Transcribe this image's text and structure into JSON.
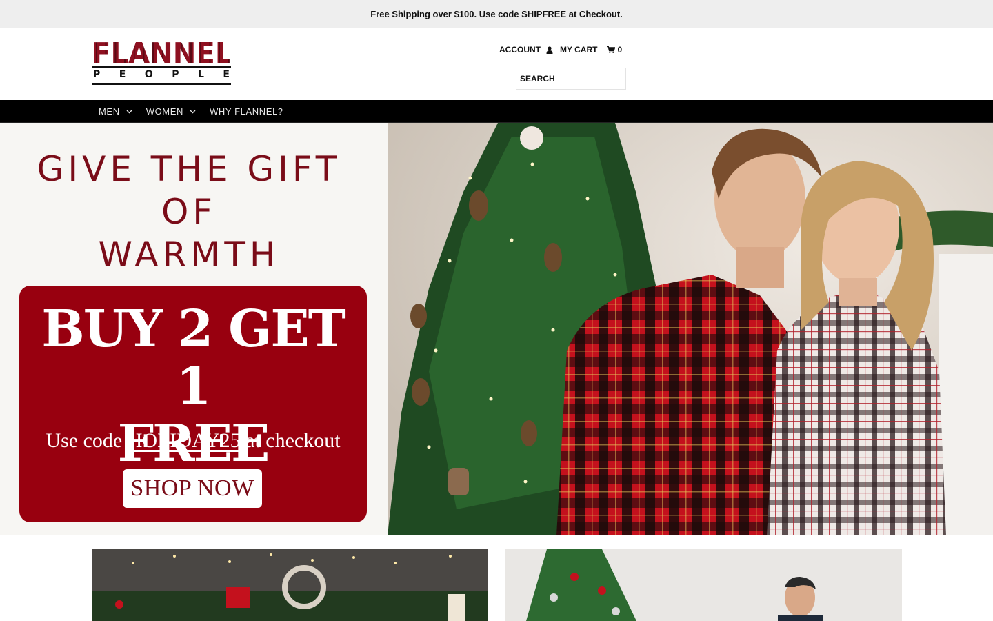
{
  "announcement": "Free Shipping over $100. Use code SHIPFREE at Checkout.",
  "logo": {
    "top": "FLANNEL",
    "bottom": [
      "P",
      "E",
      "O",
      "P",
      "L",
      "E"
    ]
  },
  "header": {
    "account_label": "ACCOUNT",
    "cart_label": "MY CART",
    "cart_count": "0",
    "search_placeholder": "SEARCH"
  },
  "nav": {
    "items": [
      {
        "label": "MEN",
        "has_dropdown": true
      },
      {
        "label": "WOMEN",
        "has_dropdown": true
      },
      {
        "label": "WHY FLANNEL?",
        "has_dropdown": false
      }
    ]
  },
  "hero": {
    "headline": [
      "GIVE THE GIFT",
      "OF",
      "WARMTH"
    ],
    "promo_line1": "BUY 2 GET 1",
    "promo_line2": "FREE",
    "code_prefix": "Use code ",
    "code": "HOLIDAY25",
    "code_suffix": " at checkout",
    "cta": "SHOP NOW"
  },
  "colors": {
    "brand_red": "#98000f",
    "headline_red": "#7a0c18",
    "nav_bg": "#000000",
    "announce_bg": "#eeeeee"
  }
}
